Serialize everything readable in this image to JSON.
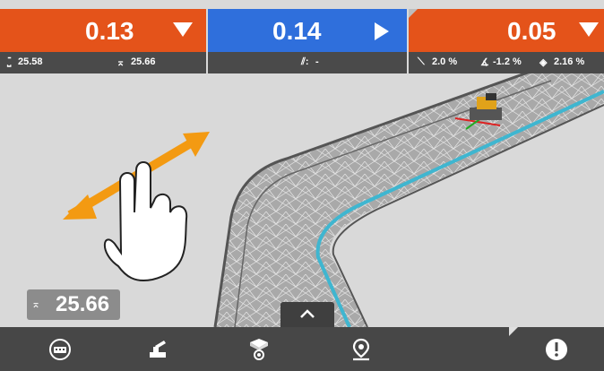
{
  "top_panels": {
    "left": {
      "value": "0.13",
      "sub_left": "25.58",
      "sub_right": "25.66"
    },
    "middle": {
      "value": "0.14",
      "sub": "-"
    },
    "right": {
      "value": "0.05",
      "slope1": "2.0 %",
      "slope2": "-1.2 %",
      "slope3": "2.16 %"
    }
  },
  "height_badge": {
    "value": "25.66"
  },
  "colors": {
    "orange": "#e4531a",
    "blue": "#2f6fdc",
    "bar": "#474747",
    "gesture_arrow": "#f39a12",
    "edge_line": "#3fb6d0"
  },
  "icons": {
    "left_arrow": "triangle-down-icon",
    "middle_arrow": "triangle-right-icon",
    "right_arrow": "triangle-down-icon",
    "bottom": [
      "keyboard-icon",
      "machine-icon",
      "view-orientation-icon",
      "location-pin-icon",
      "info-alert-icon"
    ]
  }
}
